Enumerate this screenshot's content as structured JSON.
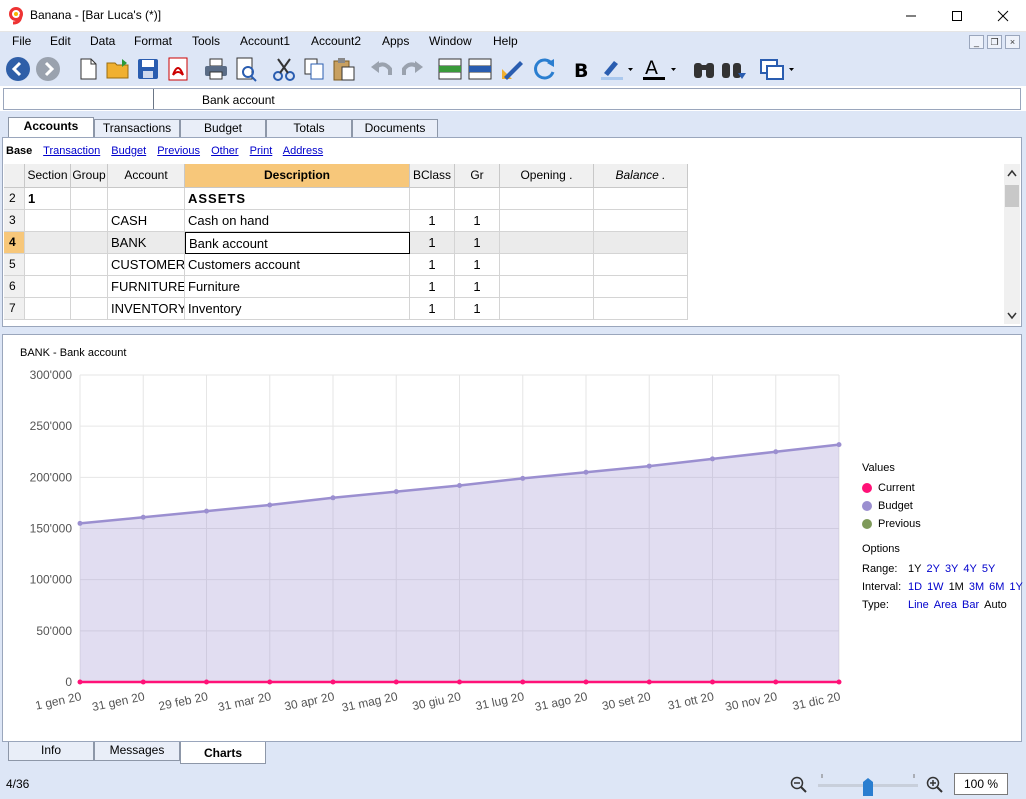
{
  "window": {
    "title": "Banana - [Bar Luca's (*)]"
  },
  "menu": [
    "File",
    "Edit",
    "Data",
    "Format",
    "Tools",
    "Account1",
    "Account2",
    "Apps",
    "Window",
    "Help"
  ],
  "cellbar": {
    "value": "Bank account"
  },
  "tabs": [
    "Accounts",
    "Transactions",
    "Budget",
    "Totals",
    "Documents"
  ],
  "views": [
    "Base",
    "Transaction",
    "Budget",
    "Previous",
    "Other",
    "Print",
    "Address"
  ],
  "table": {
    "headers": [
      "Section",
      "Group",
      "Account",
      "Description",
      "BClass",
      "Gr",
      "Opening .",
      "Balance ."
    ],
    "rows": [
      {
        "n": "2",
        "section": "1",
        "group": "",
        "account": "",
        "desc": "ASSETS",
        "bclass": "",
        "gr": ""
      },
      {
        "n": "3",
        "section": "",
        "group": "",
        "account": "CASH",
        "desc": "Cash on hand",
        "bclass": "1",
        "gr": "1"
      },
      {
        "n": "4",
        "section": "",
        "group": "",
        "account": "BANK",
        "desc": "Bank account",
        "bclass": "1",
        "gr": "1"
      },
      {
        "n": "5",
        "section": "",
        "group": "",
        "account": "CUSTOMER",
        "desc": "Customers account",
        "bclass": "1",
        "gr": "1"
      },
      {
        "n": "6",
        "section": "",
        "group": "",
        "account": "FURNITURE",
        "desc": "Furniture",
        "bclass": "1",
        "gr": "1"
      },
      {
        "n": "7",
        "section": "",
        "group": "",
        "account": "INVENTORY",
        "desc": "Inventory",
        "bclass": "1",
        "gr": "1"
      }
    ]
  },
  "chart_data": {
    "type": "area",
    "title": "BANK - Bank account",
    "x": [
      "1 gen 20",
      "31 gen 20",
      "29 feb 20",
      "31 mar 20",
      "30 apr 20",
      "31 mag 20",
      "30 giu 20",
      "31 lug 20",
      "31 ago 20",
      "30 set 20",
      "31 ott 20",
      "30 nov 20",
      "31 dic 20"
    ],
    "yticks": [
      "0",
      "50'000",
      "100'000",
      "150'000",
      "200'000",
      "250'000",
      "300'000"
    ],
    "ylim": [
      0,
      300000
    ],
    "series": [
      {
        "name": "Current",
        "color": "#ff1177",
        "values": [
          0,
          0,
          0,
          0,
          0,
          0,
          0,
          0,
          0,
          0,
          0,
          0,
          0
        ]
      },
      {
        "name": "Budget",
        "color": "#9b8fd0",
        "values": [
          155000,
          161000,
          167000,
          173000,
          180000,
          186000,
          192000,
          199000,
          205000,
          211000,
          218000,
          225000,
          232000
        ]
      },
      {
        "name": "Previous",
        "color": "#7e9a5a",
        "values": []
      }
    ],
    "grid": true,
    "legend": "right"
  },
  "legend": {
    "head": "Values",
    "items": [
      "Current",
      "Budget",
      "Previous"
    ]
  },
  "options": {
    "head": "Options",
    "range_label": "Range:",
    "range": [
      "1Y",
      "2Y",
      "3Y",
      "4Y",
      "5Y"
    ],
    "interval_label": "Interval:",
    "interval": [
      "1D",
      "1W",
      "1M",
      "3M",
      "6M",
      "1Y"
    ],
    "type_label": "Type:",
    "type": [
      "Line",
      "Area",
      "Bar",
      "Auto"
    ]
  },
  "bottom_tabs": [
    "Info",
    "Messages",
    "Charts"
  ],
  "status": {
    "position": "4/36",
    "zoom": "100 %"
  }
}
